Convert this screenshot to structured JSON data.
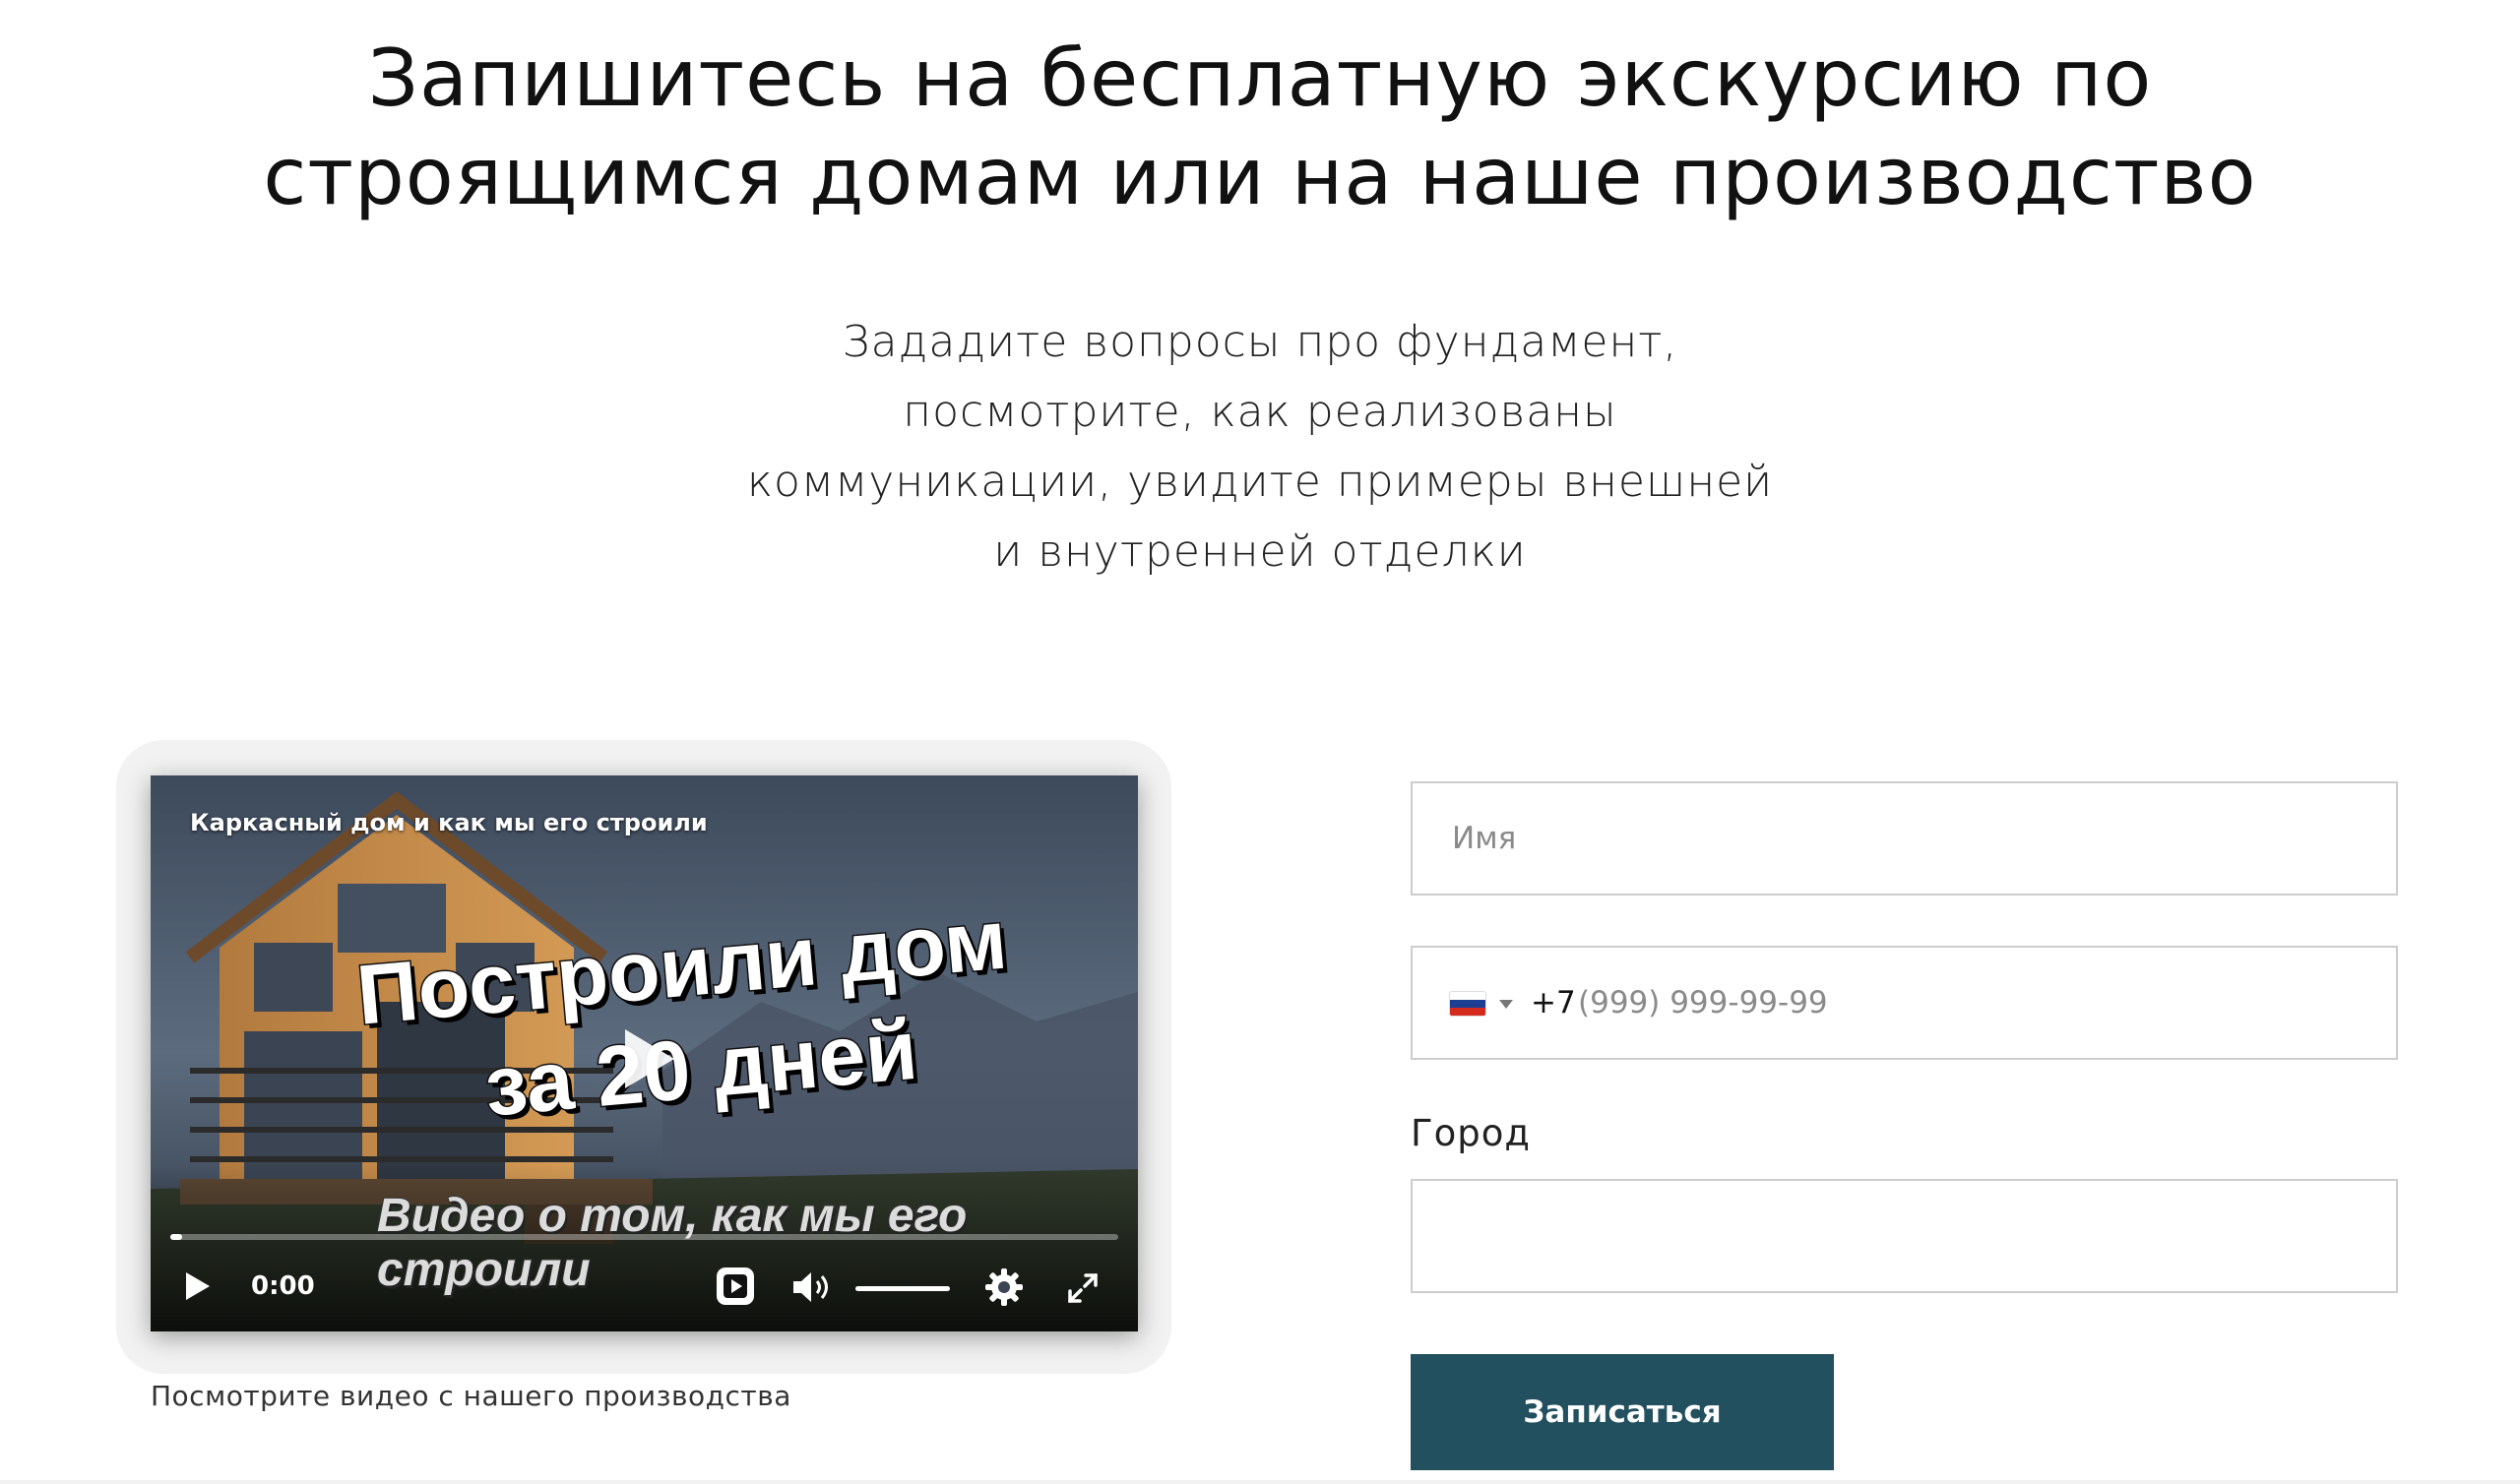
{
  "heading": {
    "line1": "Запишитесь на бесплатную экскурсию по",
    "line2": "строящимся домам или на наше производство"
  },
  "subtitle": {
    "line1": "Зададите вопросы про фундамент,",
    "line2": "посмотрите, как реализованы",
    "line3": "коммуникации, увидите примеры внешней",
    "line4": "и внутренней отделки"
  },
  "video": {
    "title": "Каркасный дом и как мы его строили",
    "overlay_line1": "Построили дом",
    "overlay_line2": "за 20 дней",
    "overlay_line3": "Видео о том, как мы его строили",
    "time": "0:00",
    "progress_fraction": 0.0,
    "volume_fraction": 1.0,
    "icons": [
      "play-icon",
      "volume-icon",
      "settings-gear-icon",
      "fullscreen-icon"
    ]
  },
  "caption": "Посмотрите видео с нашего производства",
  "form": {
    "name_placeholder": "Имя",
    "phone_prefix": "+7",
    "phone_placeholder": "(999) 999-99-99",
    "phone_country": "RU",
    "city_label": "Город",
    "city_value": "",
    "submit_label": "Записаться"
  },
  "colors": {
    "submit_bg": "#22505f",
    "field_border": "#cdcdcd"
  }
}
